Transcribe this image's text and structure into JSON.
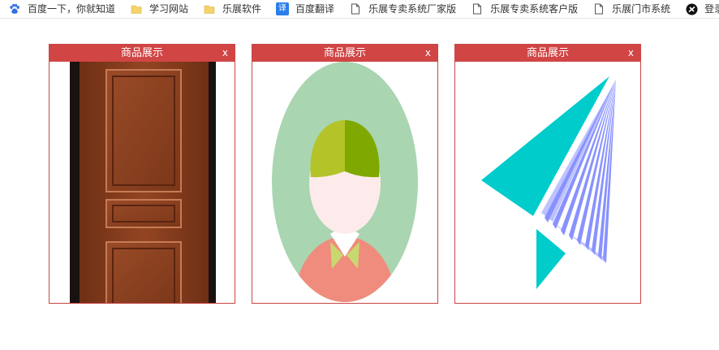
{
  "bookmarks": [
    {
      "icon": "baidu-paw-icon",
      "label": "百度一下，你就知道"
    },
    {
      "icon": "folder-icon",
      "label": "学习网站"
    },
    {
      "icon": "folder-icon",
      "label": "乐展软件"
    },
    {
      "icon": "translate-icon",
      "icon_text": "译",
      "label": "百度翻译"
    },
    {
      "icon": "page-icon",
      "label": "乐展专卖系统厂家版"
    },
    {
      "icon": "page-icon",
      "label": "乐展专卖系统客户版"
    },
    {
      "icon": "page-icon",
      "label": "乐展门市系统"
    },
    {
      "icon": "login-circle-icon",
      "label": "登录--"
    }
  ],
  "cards": [
    {
      "title": "商品展示",
      "close": "x",
      "image": "wooden-door-image"
    },
    {
      "title": "商品展示",
      "close": "x",
      "image": "avatar-girl-image"
    },
    {
      "title": "商品展示",
      "close": "x",
      "image": "paper-plane-image"
    }
  ],
  "colors": {
    "card_header": "#d14545",
    "card_border": "#c94545",
    "door_wood": "#8a3f1e",
    "avatar_bg": "#a9d5b1",
    "avatar_hair": "#7fa800",
    "avatar_skin": "#fcebea",
    "avatar_shirt": "#f08c7d",
    "plane_teal": "#00cccc",
    "plane_blue": "#8892ff"
  }
}
